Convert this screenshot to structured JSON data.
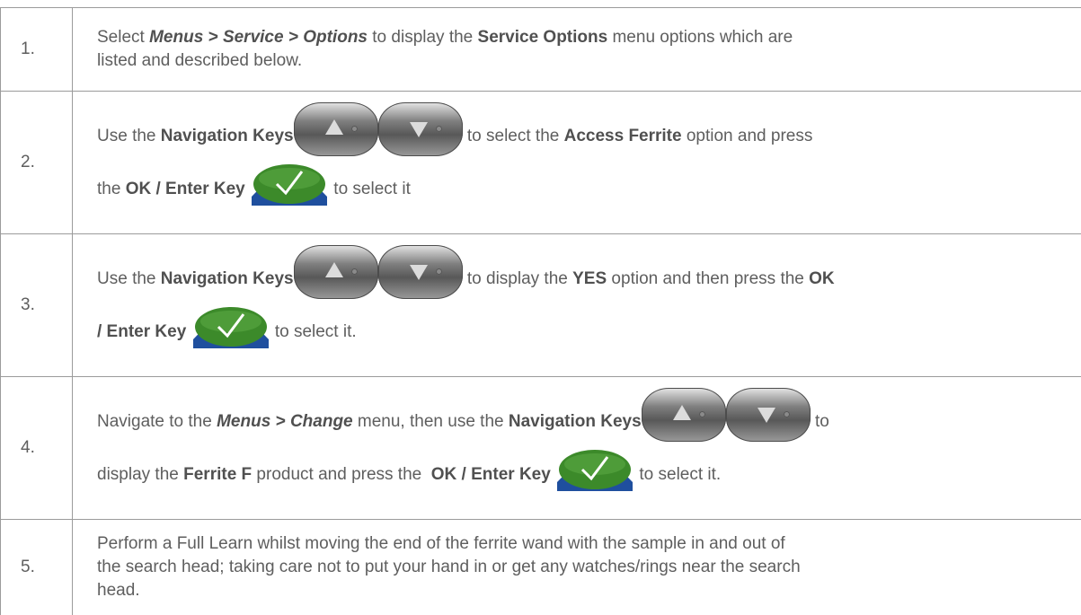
{
  "steps": [
    {
      "num": "1.",
      "lines": [
        {
          "pre": "Select ",
          "menu1": "Menus",
          "sep1": " > ",
          "menu2": "Service",
          "sep2": " > ",
          "menu3": "Options",
          "mid": " to display the ",
          "bold": "Service Options",
          "post": " menu options which are"
        },
        {
          "text": "listed and described below."
        }
      ]
    },
    {
      "num": "2.",
      "lines": [
        {
          "pre": "Use the ",
          "bold1": "Navigation Keys",
          "mid": " to select the ",
          "bold2": "Access Ferrite",
          "post": " option and press"
        },
        {
          "pre": "the ",
          "bold1": "OK / Enter Key",
          "post": " to select it"
        }
      ]
    },
    {
      "num": "3.",
      "lines": [
        {
          "pre": "Use the ",
          "bold1": "Navigation Keys",
          "mid": " to display the ",
          "bold2": "YES",
          "post": " option and then press the ",
          "bold3": "OK"
        },
        {
          "bold1": "/ Enter Key",
          "post": " to select it."
        }
      ]
    },
    {
      "num": "4.",
      "lines": [
        {
          "pre": "Navigate to the ",
          "menu1": "Menus",
          "sep1": " > ",
          "menu2": "Change",
          "mid": " menu, then use the ",
          "bold1": "Navigation Keys",
          "post": " to"
        },
        {
          "pre": "display the ",
          "bold1": "Ferrite F",
          "mid": " product and press the  ",
          "bold2": "OK / Enter Key",
          "post": " to select it."
        }
      ]
    },
    {
      "num": "5.",
      "lines": [
        {
          "text": "Perform a Full Learn whilst moving the end of the ferrite wand with the sample in and out of"
        },
        {
          "text": "the search head; taking care not to put your hand in or get any watches/rings near the search"
        },
        {
          "text": "head."
        }
      ]
    }
  ],
  "icons": {
    "nav_up": "navigation-up-key-icon",
    "nav_down": "navigation-down-key-icon",
    "ok_enter": "ok-enter-key-icon"
  },
  "colors": {
    "text": "#5e5e5e",
    "border": "#9b9b9b",
    "ok_green": "#3c8a2a",
    "ok_blue": "#1f4f9e"
  }
}
